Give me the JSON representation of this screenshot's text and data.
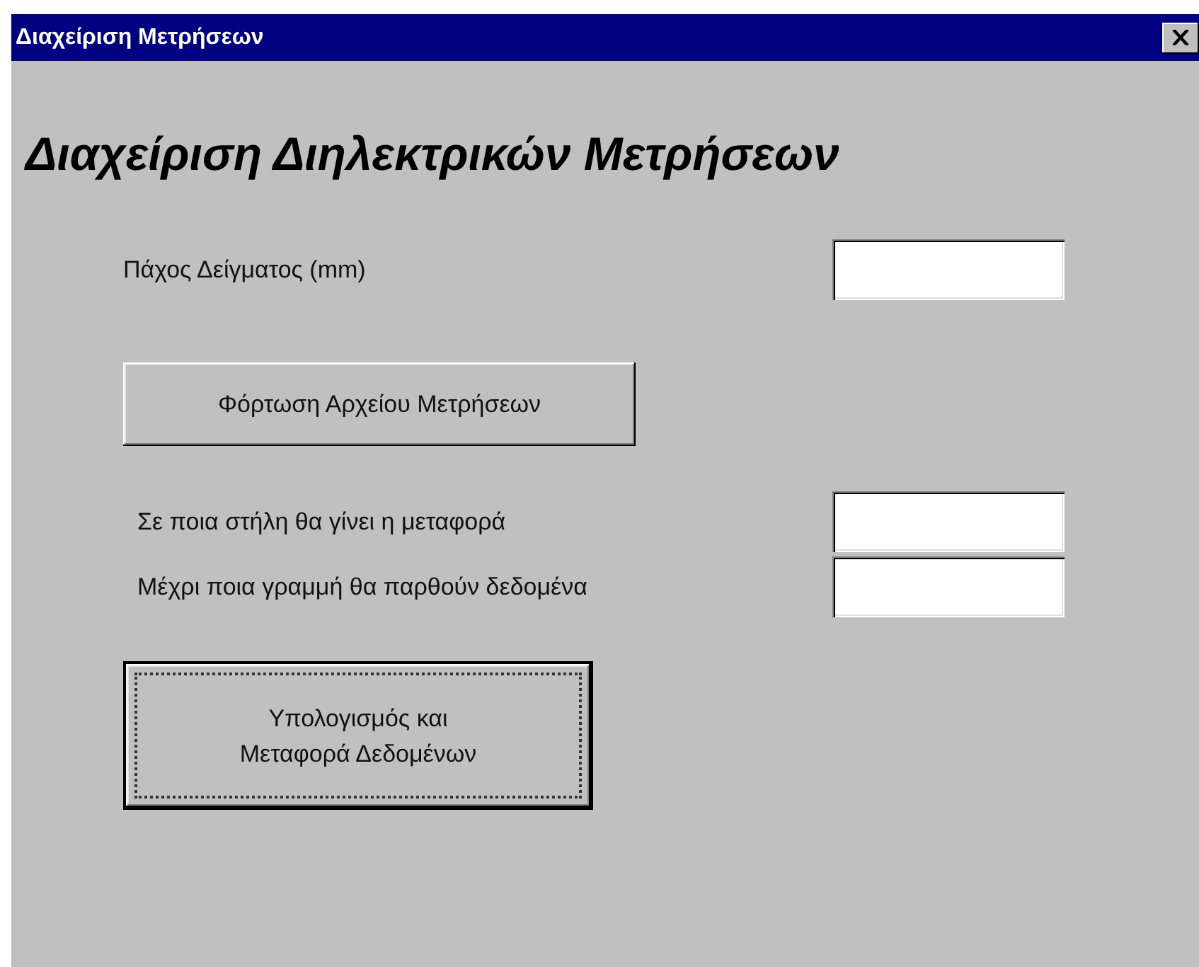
{
  "window": {
    "title": "Διαχείριση Μετρήσεων"
  },
  "heading": "Διαχείριση Διηλεκτρικών Μετρήσεων",
  "thickness": {
    "label": "Πάχος Δείγματος (mm)"
  },
  "load_button": {
    "label": "Φόρτωση Αρχείου Μετρήσεων",
    "focused": false
  },
  "fields": [
    {
      "label": "Σε ποια στήλη θα γίνει η μεταφορά"
    },
    {
      "label": "Μέχρι ποια γραμμή θα παρθούν  δεδομένα"
    }
  ],
  "compute_button": {
    "label": "Υπολογισμός και\nΜεταφορά Δεδομένων",
    "focused": true
  }
}
